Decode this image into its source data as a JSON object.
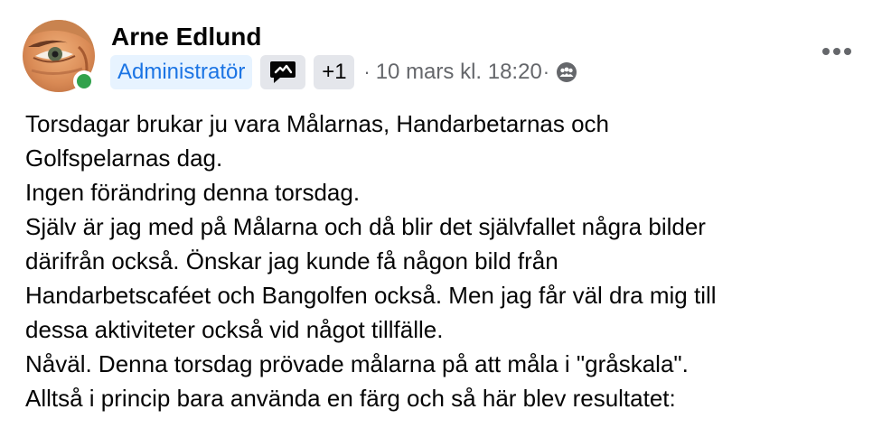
{
  "post": {
    "author": "Arne Edlund",
    "role_badge": "Administratör",
    "extra_badge_count": "+1",
    "separator": "·",
    "timestamp": "10 mars kl. 18:20",
    "icons": {
      "avatar": "profile-photo",
      "online_status": "online-dot",
      "badge": "conversation-starter-badge-icon",
      "audience": "group-members-icon",
      "more": "more-options-icon"
    },
    "colors": {
      "role_badge_bg": "#e7f3ff",
      "role_badge_text": "#1b74e4",
      "chip_bg": "#e4e6eb",
      "secondary_text": "#65676b",
      "online": "#31a24c"
    },
    "lines": [
      "Torsdagar brukar ju vara Målarnas, Handarbetarnas och",
      "Golfspelarnas dag.",
      "Ingen förändring denna torsdag.",
      "Själv är jag med på Målarna och då blir det självfallet några bilder",
      "därifrån också. Önskar jag kunde få någon bild från",
      "Handarbetscaféet och Bangolfen också. Men jag får väl dra mig till",
      "dessa aktiviteter också vid något tillfälle.",
      "Nåväl. Denna torsdag prövade målarna på att måla i \"gråskala\".",
      "Alltså i princip bara använda en färg och så här blev resultatet:"
    ]
  }
}
